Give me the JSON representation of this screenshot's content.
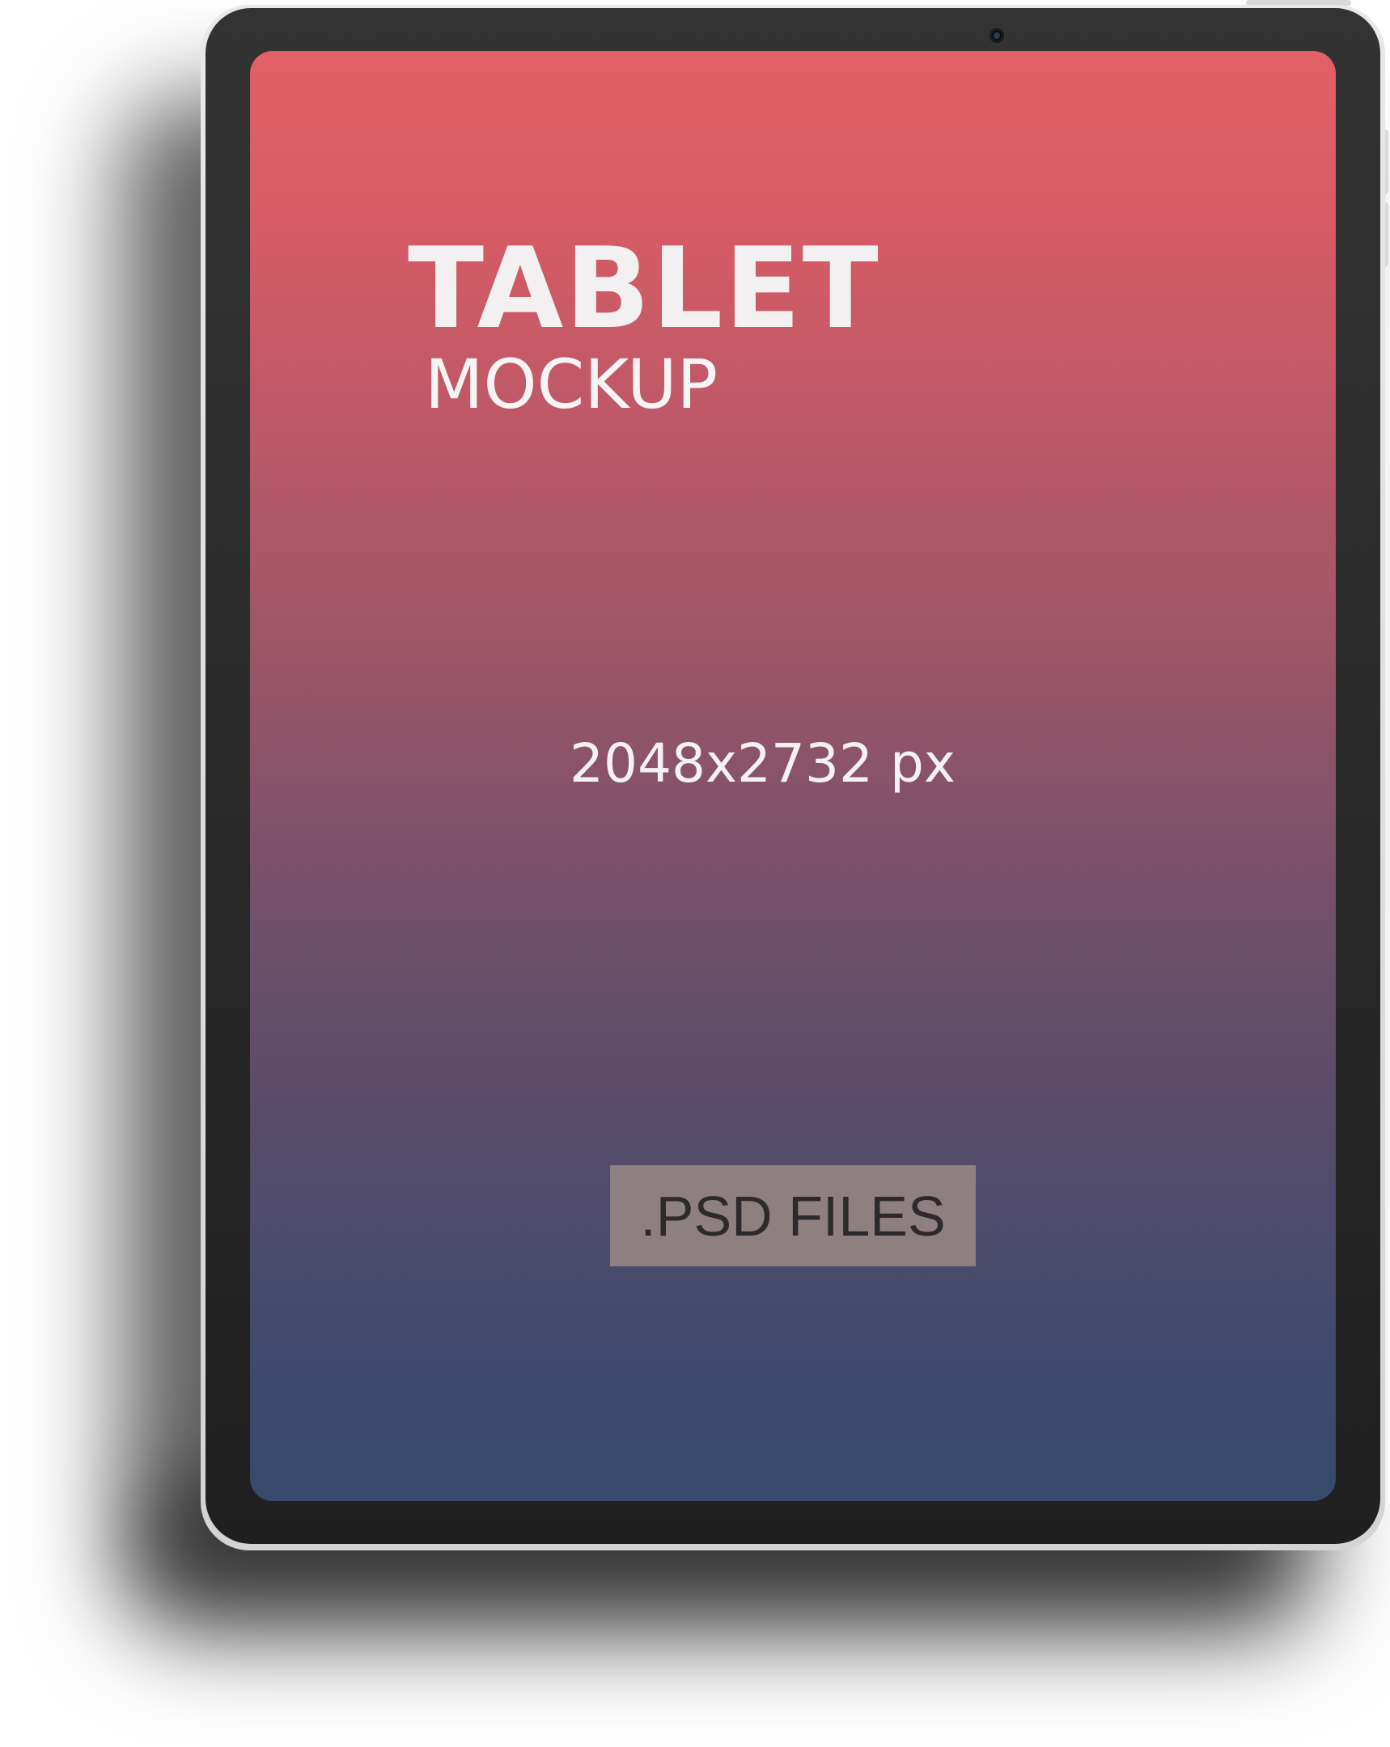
{
  "screen": {
    "title": "TABLET",
    "subtitle": "MOCKUP",
    "dimensions": "2048x2732 px",
    "badge": ".PSD FILES"
  },
  "colors": {
    "gradient_top": "#e26066",
    "gradient_bottom": "#374a6c",
    "bezel": "#2a2a2a",
    "badge_bg": "#8e8080",
    "text_light": "#f2f0f1",
    "badge_text": "#2c2a2c"
  }
}
